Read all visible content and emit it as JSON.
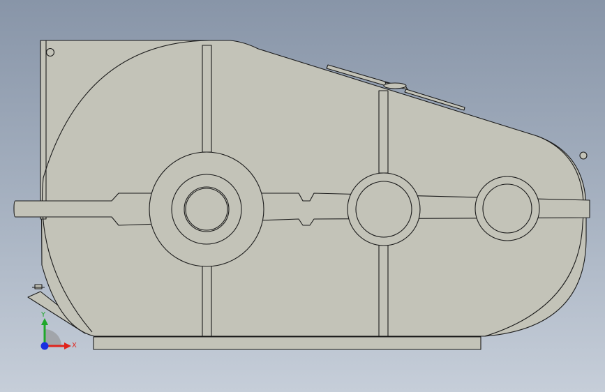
{
  "colors": {
    "background_top": "#8895a8",
    "background_bottom": "#c6ced9",
    "housing": "#c3c3b8",
    "edge": "#1a1a1a",
    "axis_x": "#e0231b",
    "axis_y": "#1fa82b",
    "axis_z": "#1a2fe0"
  },
  "triad": {
    "x_label": "X",
    "y_label": "Y"
  }
}
